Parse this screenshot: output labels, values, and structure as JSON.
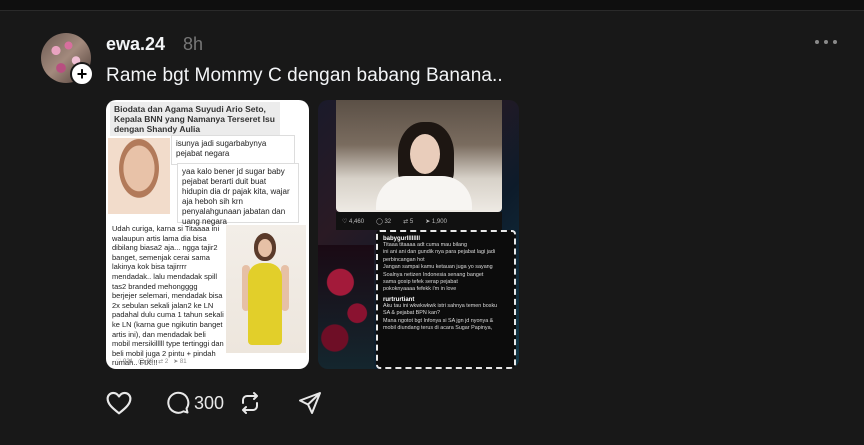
{
  "post": {
    "username": "ewa.24",
    "time": "8h",
    "caption": "Rame bgt Mommy C dengan babang Banana..",
    "follow_symbol": "+",
    "reply_count": "300"
  },
  "image1": {
    "headline": "Biodata dan Agama Suyudi Ario Seto, Kepala BNN yang Namanya Terseret Isu dengan Shandy Aulia",
    "bubble1": "isunya jadi sugarbabynya pejabat negara",
    "bubble2": "yaa kalo bener jd sugar baby pejabat berarti duit buat hidupin dia dr pajak kita, wajar aja heboh sih krn penyalahgunaan jabatan dan uang negara",
    "body": "Udah curiga, karna si Titaaaa ini walaupun artis lama dia bisa dibilang biasa2 aja... ngga tajir2 banget, semenjak cerai sama lakinya kok bisa tajirrrr mendadak.. lalu mendadak spill tas2 branded mehongggg berjejer selemari, mendadak bisa 2x sebulan sekali jalan2 ke LN padahal dulu cuma 1 tahun sekali ke LN (karna gue ngikutin banget artis ini), dan mendadak beli mobil mersikilllll type tertinggi dan beli mobil juga 2 pintu + pindah rumah.. FIX!!!",
    "footer_counts": [
      "921",
      "28",
      "2",
      "81"
    ]
  },
  "image2": {
    "photo_bar_counts": [
      "4,460",
      "32",
      "5",
      "1,900"
    ],
    "comments": [
      {
        "name": "babygurllllllll",
        "lines": [
          "Titaaa titaaaa adt cuma mau bilang",
          "ini ani ani dan gundik nya para pejabat lagi jadi",
          "perbincangan hot",
          "Jangan sampai kamu ketauan juga yo sayang",
          "Soalnya netizen Indonesia senang banget",
          "sama gosip tefek serap pejabat",
          "pokoknyaaaa fefekk i'm in love"
        ]
      },
      {
        "name": "rurtrurtiant",
        "lines": [
          "Aku tau ini wkwkwkwk istri sahnya temen bosku",
          "SA & pejabat BPN kan?",
          "Mana ngotot bgt Infonya si SA jgn jd nyonya &",
          "mobil diundang terus di acara Sugar Papinya,"
        ]
      }
    ]
  },
  "icons": [
    "heart-icon",
    "reply-icon",
    "repost-icon",
    "share-icon",
    "more-icon"
  ]
}
